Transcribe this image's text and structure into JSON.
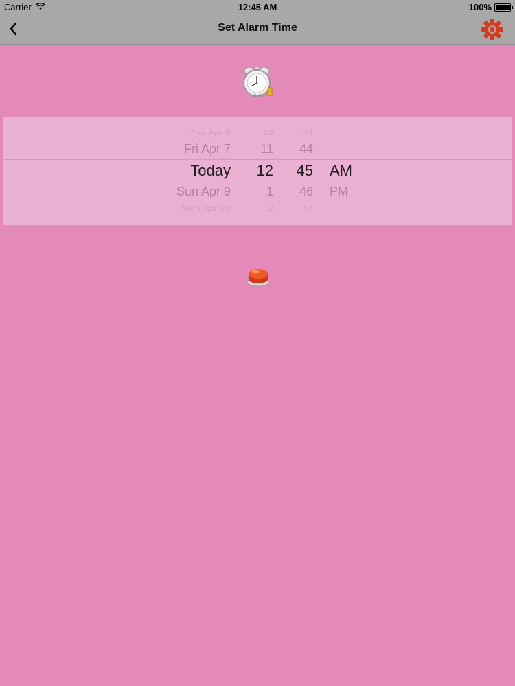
{
  "status_bar": {
    "carrier": "Carrier",
    "time": "12:45 AM",
    "battery": "100%"
  },
  "nav": {
    "title": "Set Alarm Time"
  },
  "picker": {
    "rows": [
      {
        "date": "Thu Apr 6",
        "hour": "10",
        "minute": "43",
        "ampm": ""
      },
      {
        "date": "Fri Apr 7",
        "hour": "11",
        "minute": "44",
        "ampm": ""
      },
      {
        "date": "Today",
        "hour": "12",
        "minute": "45",
        "ampm": "AM"
      },
      {
        "date": "Sun Apr 9",
        "hour": "1",
        "minute": "46",
        "ampm": "PM"
      },
      {
        "date": "Mon Apr 10",
        "hour": "2",
        "minute": "47",
        "ampm": ""
      }
    ]
  },
  "icons": {
    "back": "chevron-left-icon",
    "settings": "gear-icon",
    "clock": "alarm-clock-icon",
    "button": "red-button-icon"
  },
  "colors": {
    "background": "#e48ab8",
    "bar": "#a9a8a8",
    "gear": "#d83a1c",
    "button": "#ef4f1e"
  }
}
